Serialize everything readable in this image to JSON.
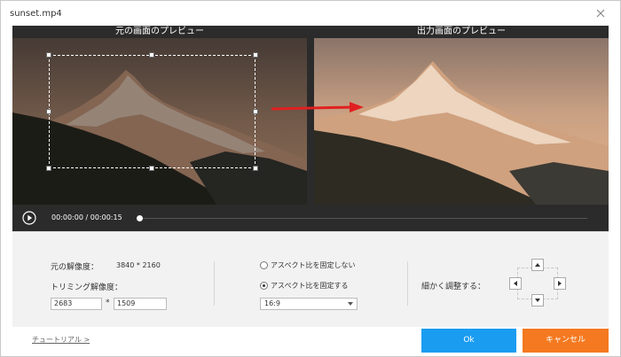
{
  "window": {
    "title": "sunset.mp4"
  },
  "preview": {
    "source_title": "元の画面のプレビュー",
    "output_title": "出力画面のプレビュー"
  },
  "player": {
    "current_time": "00:00:00",
    "separator": "/",
    "total_time": "00:00:15",
    "progress": 0
  },
  "settings": {
    "original_resolution_label": "元の解像度：",
    "original_resolution_value": "3840 * 2160",
    "trim_resolution_label": "トリミング解像度：",
    "trim_width": "2683",
    "trim_separator": "*",
    "trim_height": "1509",
    "aspect_free_label": "アスペクト比を固定しない",
    "aspect_fixed_label": "アスペクト比を固定する",
    "aspect_selected": "fixed",
    "aspect_ratio_value": "16:9",
    "fine_adjust_label": "細かく調整する："
  },
  "footer": {
    "tutorial_link": "チュートリアル >",
    "ok_label": "Ok",
    "cancel_label": "キャンセル"
  },
  "colors": {
    "ok": "#1a9cf0",
    "cancel": "#f47920",
    "arrow": "#e02020"
  }
}
